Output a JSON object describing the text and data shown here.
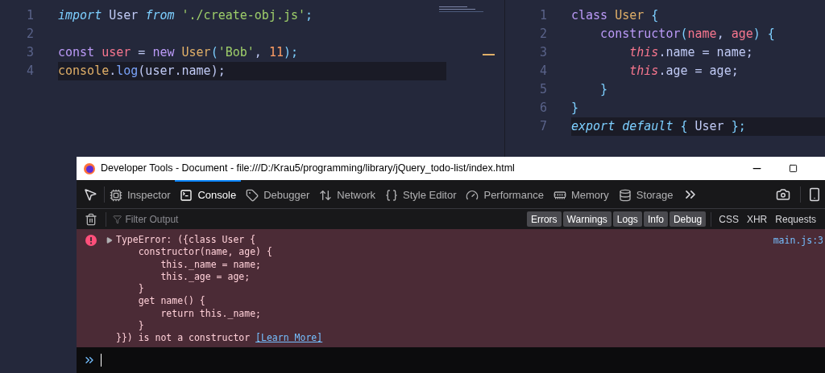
{
  "editors": [
    {
      "lines": [
        {
          "number": "1",
          "current": false,
          "tokens": [
            {
              "kind": "keyword-italic",
              "text": "import"
            },
            {
              "kind": "plain",
              "text": " User "
            },
            {
              "kind": "keyword-italic",
              "text": "from "
            },
            {
              "kind": "string",
              "text": "'./create-obj.js'"
            },
            {
              "kind": "punct",
              "text": ";"
            }
          ]
        },
        {
          "number": "2",
          "current": false
        },
        {
          "number": "3",
          "current": false,
          "tokens": [
            {
              "kind": "keyword",
              "text": "const "
            },
            {
              "kind": "variable",
              "text": "user"
            },
            {
              "kind": "plain",
              "text": " = "
            },
            {
              "kind": "keyword",
              "text": "new "
            },
            {
              "kind": "class",
              "text": "User"
            },
            {
              "kind": "punct",
              "text": "("
            },
            {
              "kind": "string",
              "text": "'Bob'"
            },
            {
              "kind": "plain",
              "text": ", "
            },
            {
              "kind": "number",
              "text": "11"
            },
            {
              "kind": "punct",
              "text": ");"
            }
          ]
        },
        {
          "number": "4",
          "current": true,
          "tokens": [
            {
              "kind": "class",
              "text": "console"
            },
            {
              "kind": "plain",
              "text": "."
            },
            {
              "kind": "function",
              "text": "log"
            },
            {
              "kind": "plain",
              "text": "(user.name);"
            }
          ]
        }
      ]
    },
    {
      "lines": [
        {
          "number": "1",
          "current": false,
          "tokens": [
            {
              "kind": "keyword",
              "text": "class "
            },
            {
              "kind": "class",
              "text": "User "
            },
            {
              "kind": "punct",
              "text": "{"
            }
          ]
        },
        {
          "number": "2",
          "current": false,
          "tokens": [
            {
              "kind": "keyword",
              "text": "    constructor"
            },
            {
              "kind": "punct",
              "text": "("
            },
            {
              "kind": "variable",
              "text": "name"
            },
            {
              "kind": "plain",
              "text": ", "
            },
            {
              "kind": "variable",
              "text": "age"
            },
            {
              "kind": "punct",
              "text": ") {"
            }
          ]
        },
        {
          "number": "3",
          "current": false,
          "tokens": [
            {
              "kind": "this",
              "text": "        this"
            },
            {
              "kind": "plain",
              "text": ".name = name;"
            }
          ]
        },
        {
          "number": "4",
          "current": false,
          "tokens": [
            {
              "kind": "this",
              "text": "        this"
            },
            {
              "kind": "plain",
              "text": ".age = age;"
            }
          ]
        },
        {
          "number": "5",
          "current": false,
          "tokens": [
            {
              "kind": "punct",
              "text": "    }"
            }
          ]
        },
        {
          "number": "6",
          "current": false,
          "tokens": [
            {
              "kind": "punct",
              "text": "}"
            }
          ]
        },
        {
          "number": "7",
          "current": true,
          "tokens": [
            {
              "kind": "keyword-italic",
              "text": "export "
            },
            {
              "kind": "keyword-italic",
              "text": "default "
            },
            {
              "kind": "punct",
              "text": "{"
            },
            {
              "kind": "plain",
              "text": " User "
            },
            {
              "kind": "punct",
              "text": "};"
            }
          ]
        }
      ]
    }
  ],
  "devtools": {
    "title": "Developer Tools - Document - file:///D:/Krau5/programming/library/jQuery_todo-list/index.html",
    "tabs": [
      {
        "label": "Inspector",
        "selected": false
      },
      {
        "label": "Console",
        "selected": true
      },
      {
        "label": "Debugger",
        "selected": false
      },
      {
        "label": "Network",
        "selected": false
      },
      {
        "label": "Style Editor",
        "selected": false
      },
      {
        "label": "Performance",
        "selected": false
      },
      {
        "label": "Memory",
        "selected": false
      },
      {
        "label": "Storage",
        "selected": false
      }
    ],
    "filter": {
      "placeholder": "Filter Output"
    },
    "levels": [
      {
        "label": "Errors",
        "selected": true
      },
      {
        "label": "Warnings",
        "selected": true
      },
      {
        "label": "Logs",
        "selected": true
      },
      {
        "label": "Info",
        "selected": true
      },
      {
        "label": "Debug",
        "selected": true
      }
    ],
    "requests": [
      {
        "label": "CSS",
        "selected": false
      },
      {
        "label": "XHR",
        "selected": false
      },
      {
        "label": "Requests",
        "selected": false
      }
    ],
    "error": {
      "lines": [
        "TypeError: ({class User {",
        "    constructor(name, age) {",
        "        this._name = name;",
        "        this._age = age;",
        "    }",
        "    get name() {",
        "        return this._name;",
        "    }",
        "}}) is not a constructor "
      ],
      "link": "[Learn More]",
      "source": "main.js:3"
    }
  }
}
